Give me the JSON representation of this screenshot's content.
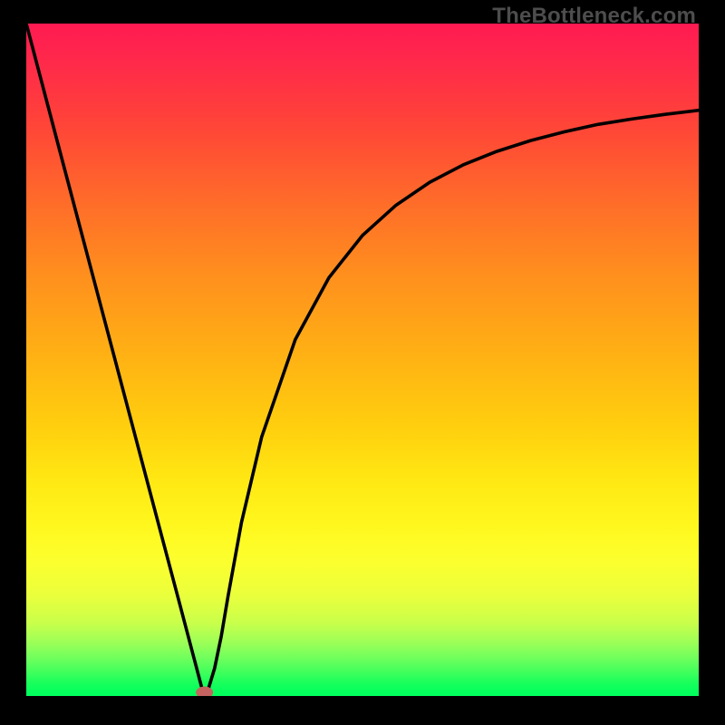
{
  "watermark": "TheBottleneck.com",
  "chart_data": {
    "type": "line",
    "title": "",
    "xlabel": "",
    "ylabel": "",
    "xlim": [
      0,
      1
    ],
    "ylim": [
      0,
      1
    ],
    "series": [
      {
        "name": "bottleneck-curve",
        "x": [
          0.0,
          0.05,
          0.1,
          0.15,
          0.2,
          0.23,
          0.25,
          0.26,
          0.265,
          0.27,
          0.28,
          0.29,
          0.3,
          0.32,
          0.35,
          0.4,
          0.45,
          0.5,
          0.55,
          0.6,
          0.65,
          0.7,
          0.75,
          0.8,
          0.85,
          0.9,
          0.95,
          1.0
        ],
        "y": [
          1.0,
          0.81,
          0.621,
          0.432,
          0.243,
          0.13,
          0.054,
          0.016,
          0.0,
          0.008,
          0.041,
          0.089,
          0.148,
          0.258,
          0.385,
          0.53,
          0.622,
          0.685,
          0.73,
          0.764,
          0.79,
          0.81,
          0.826,
          0.839,
          0.85,
          0.858,
          0.865,
          0.871
        ]
      }
    ],
    "marker": {
      "x": 0.265,
      "y": 0.0
    },
    "colors": {
      "curve": "#000000",
      "marker": "#c4635f",
      "gradient_top": "#ff1a52",
      "gradient_bottom": "#00ff5c"
    }
  }
}
